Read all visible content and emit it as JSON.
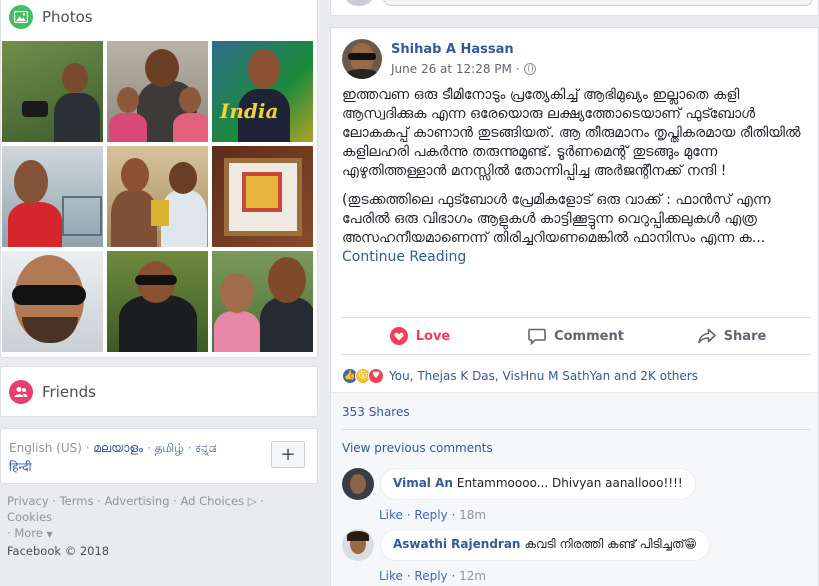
{
  "photos": {
    "title": "Photos"
  },
  "friends": {
    "title": "Friends"
  },
  "languages": {
    "items": [
      "English (US)",
      "മലയാളം",
      "தமிழ்",
      "ಕನ್ನಡ",
      "हिन्दी"
    ],
    "separator": " · ",
    "add_button": "+"
  },
  "footer": {
    "links": [
      "Privacy",
      "Terms",
      "Advertising",
      "Ad Choices",
      "Cookies",
      "More"
    ],
    "copyright": "Facebook © 2018"
  },
  "post": {
    "author": "Shihab A Hassan",
    "date": "June 26 at 12:28 PM",
    "meta_separator": "·",
    "paragraph1": "ഇത്തവണ ഒരു ടീമിനോടും പ്രത്യേകിച്ച് ആഭിമുഖ്യം ഇല്ലാതെ കളി ആസ്വദിക്കുക എന്ന ഒരേയൊരു ലക്ഷ്യത്തോടെയാണ് ഫുട്ബോൾ ലോകകപ്പ് കാണാൻ തുടങ്ങിയത്. ആ തീരുമാനം തൃപ്തികരമായ രീതിയിൽ കളിലഹരി പകർന്നു തരുന്നുമുണ്ട്. ടൂർണമെന്റ് തുടങ്ങും മുന്നേ എഴുതിത്തള്ളാൻ മനസ്സിൽ തോന്നിപ്പിച്ച അർജന്റീനക്ക് നന്ദി !",
    "paragraph2": "(തുടക്കത്തിലെ ഫുട്ബോൾ പ്രേമികളോട് ഒരു വാക്ക് : ഫാൻസ് എന്ന പേരിൽ ഒരു വിഭാഗം ആളുകൾ കാട്ടിക്കൂട്ടുന്ന വെറുപ്പിക്കലുകൾ എത്ര അസഹനീയമാണെന്ന് തിരിച്ചറിയണമെങ്കിൽ ഫാനിസം എന്ന ക...",
    "continue_reading": "Continue Reading",
    "actions": {
      "love": "Love",
      "comment": "Comment",
      "share": "Share"
    },
    "reactions_text": "You, Thejas K Das, VisHnu M SathYan and 2K others",
    "shares": "353 Shares",
    "view_previous": "View previous comments",
    "comments": [
      {
        "name": "Vimal An",
        "text": "Entammoooo... Dhivyan aanallooo!!!!",
        "like": "Like",
        "reply": "Reply",
        "time": "18m"
      },
      {
        "name": "Aswathi Rajendran",
        "text": "കവടി നിരത്തി കണ്ട് പിടിച്ചത്😁",
        "like": "Like",
        "reply": "Reply",
        "time": "12m"
      }
    ]
  },
  "colors": {
    "link": "#365899",
    "love": "#f33e58",
    "photos_icon": "#45bd62",
    "friends_icon": "#e83f6f"
  }
}
